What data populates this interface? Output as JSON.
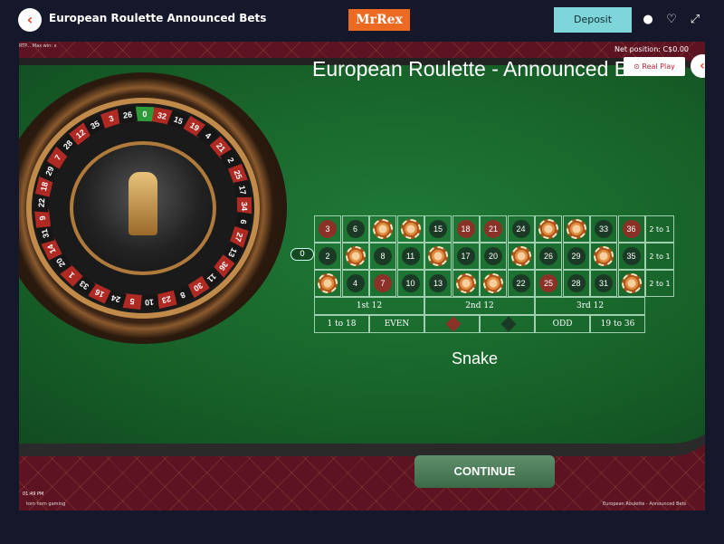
{
  "topbar": {
    "title": "European Roulette Announced Bets",
    "logo": "MrRex",
    "deposit_label": "Deposit",
    "back_icon": "chevron-left-icon",
    "chat_icon": "chat-icon",
    "favorite_icon": "heart-icon",
    "fullscreen_icon": "expand-icon"
  },
  "game": {
    "title": "European Roulette - Announced Bets",
    "net_position": "Net position: C$0.00",
    "real_play_label": "Real Play",
    "rtp_text": "RTP... Max win: x",
    "time": "01:49 PM",
    "provider": "tom horn gaming",
    "footer_name": "European Roulette - Announced Bets",
    "announced_bet": "Snake",
    "continue_label": "CONTINUE"
  },
  "wheel": {
    "pockets": [
      "0",
      "32",
      "15",
      "19",
      "4",
      "21",
      "2",
      "25",
      "17",
      "34",
      "6",
      "27",
      "13",
      "36",
      "11",
      "30",
      "8",
      "23",
      "10",
      "5",
      "24",
      "16",
      "33",
      "1",
      "20",
      "14",
      "31",
      "9",
      "22",
      "18",
      "29",
      "7",
      "28",
      "12",
      "35",
      "3",
      "26"
    ]
  },
  "table": {
    "zero": "0",
    "rows": [
      [
        {
          "n": "3",
          "c": "red"
        },
        {
          "n": "6",
          "c": "black"
        },
        {
          "n": "9",
          "c": "red",
          "chip": true
        },
        {
          "n": "12",
          "c": "red",
          "chip": true
        },
        {
          "n": "15",
          "c": "black"
        },
        {
          "n": "18",
          "c": "red"
        },
        {
          "n": "21",
          "c": "red"
        },
        {
          "n": "24",
          "c": "black"
        },
        {
          "n": "27",
          "c": "red",
          "chip": true
        },
        {
          "n": "30",
          "c": "red",
          "chip": true
        },
        {
          "n": "33",
          "c": "black"
        },
        {
          "n": "36",
          "c": "red"
        }
      ],
      [
        {
          "n": "2",
          "c": "black"
        },
        {
          "n": "5",
          "c": "red",
          "chip": true
        },
        {
          "n": "8",
          "c": "black"
        },
        {
          "n": "11",
          "c": "black"
        },
        {
          "n": "14",
          "c": "red",
          "chip": true
        },
        {
          "n": "17",
          "c": "black"
        },
        {
          "n": "20",
          "c": "black"
        },
        {
          "n": "23",
          "c": "red",
          "chip": true
        },
        {
          "n": "26",
          "c": "black"
        },
        {
          "n": "29",
          "c": "black"
        },
        {
          "n": "32",
          "c": "red",
          "chip": true
        },
        {
          "n": "35",
          "c": "black"
        }
      ],
      [
        {
          "n": "1",
          "c": "red",
          "chip": true
        },
        {
          "n": "4",
          "c": "black"
        },
        {
          "n": "7",
          "c": "red"
        },
        {
          "n": "10",
          "c": "black"
        },
        {
          "n": "13",
          "c": "black"
        },
        {
          "n": "16",
          "c": "red",
          "chip": true
        },
        {
          "n": "19",
          "c": "red",
          "chip": true
        },
        {
          "n": "22",
          "c": "black"
        },
        {
          "n": "25",
          "c": "red"
        },
        {
          "n": "28",
          "c": "black"
        },
        {
          "n": "31",
          "c": "black"
        },
        {
          "n": "34",
          "c": "red",
          "chip": true
        }
      ]
    ],
    "columns": [
      "2 to 1",
      "2 to 1",
      "2 to 1"
    ],
    "dozens": [
      "1st 12",
      "2nd 12",
      "3rd 12"
    ],
    "outside": [
      "1 to 18",
      "EVEN",
      "",
      "",
      "ODD",
      "19 to 36"
    ],
    "colors": {
      "red": "#8a3227",
      "black": "#1b3a25"
    }
  }
}
